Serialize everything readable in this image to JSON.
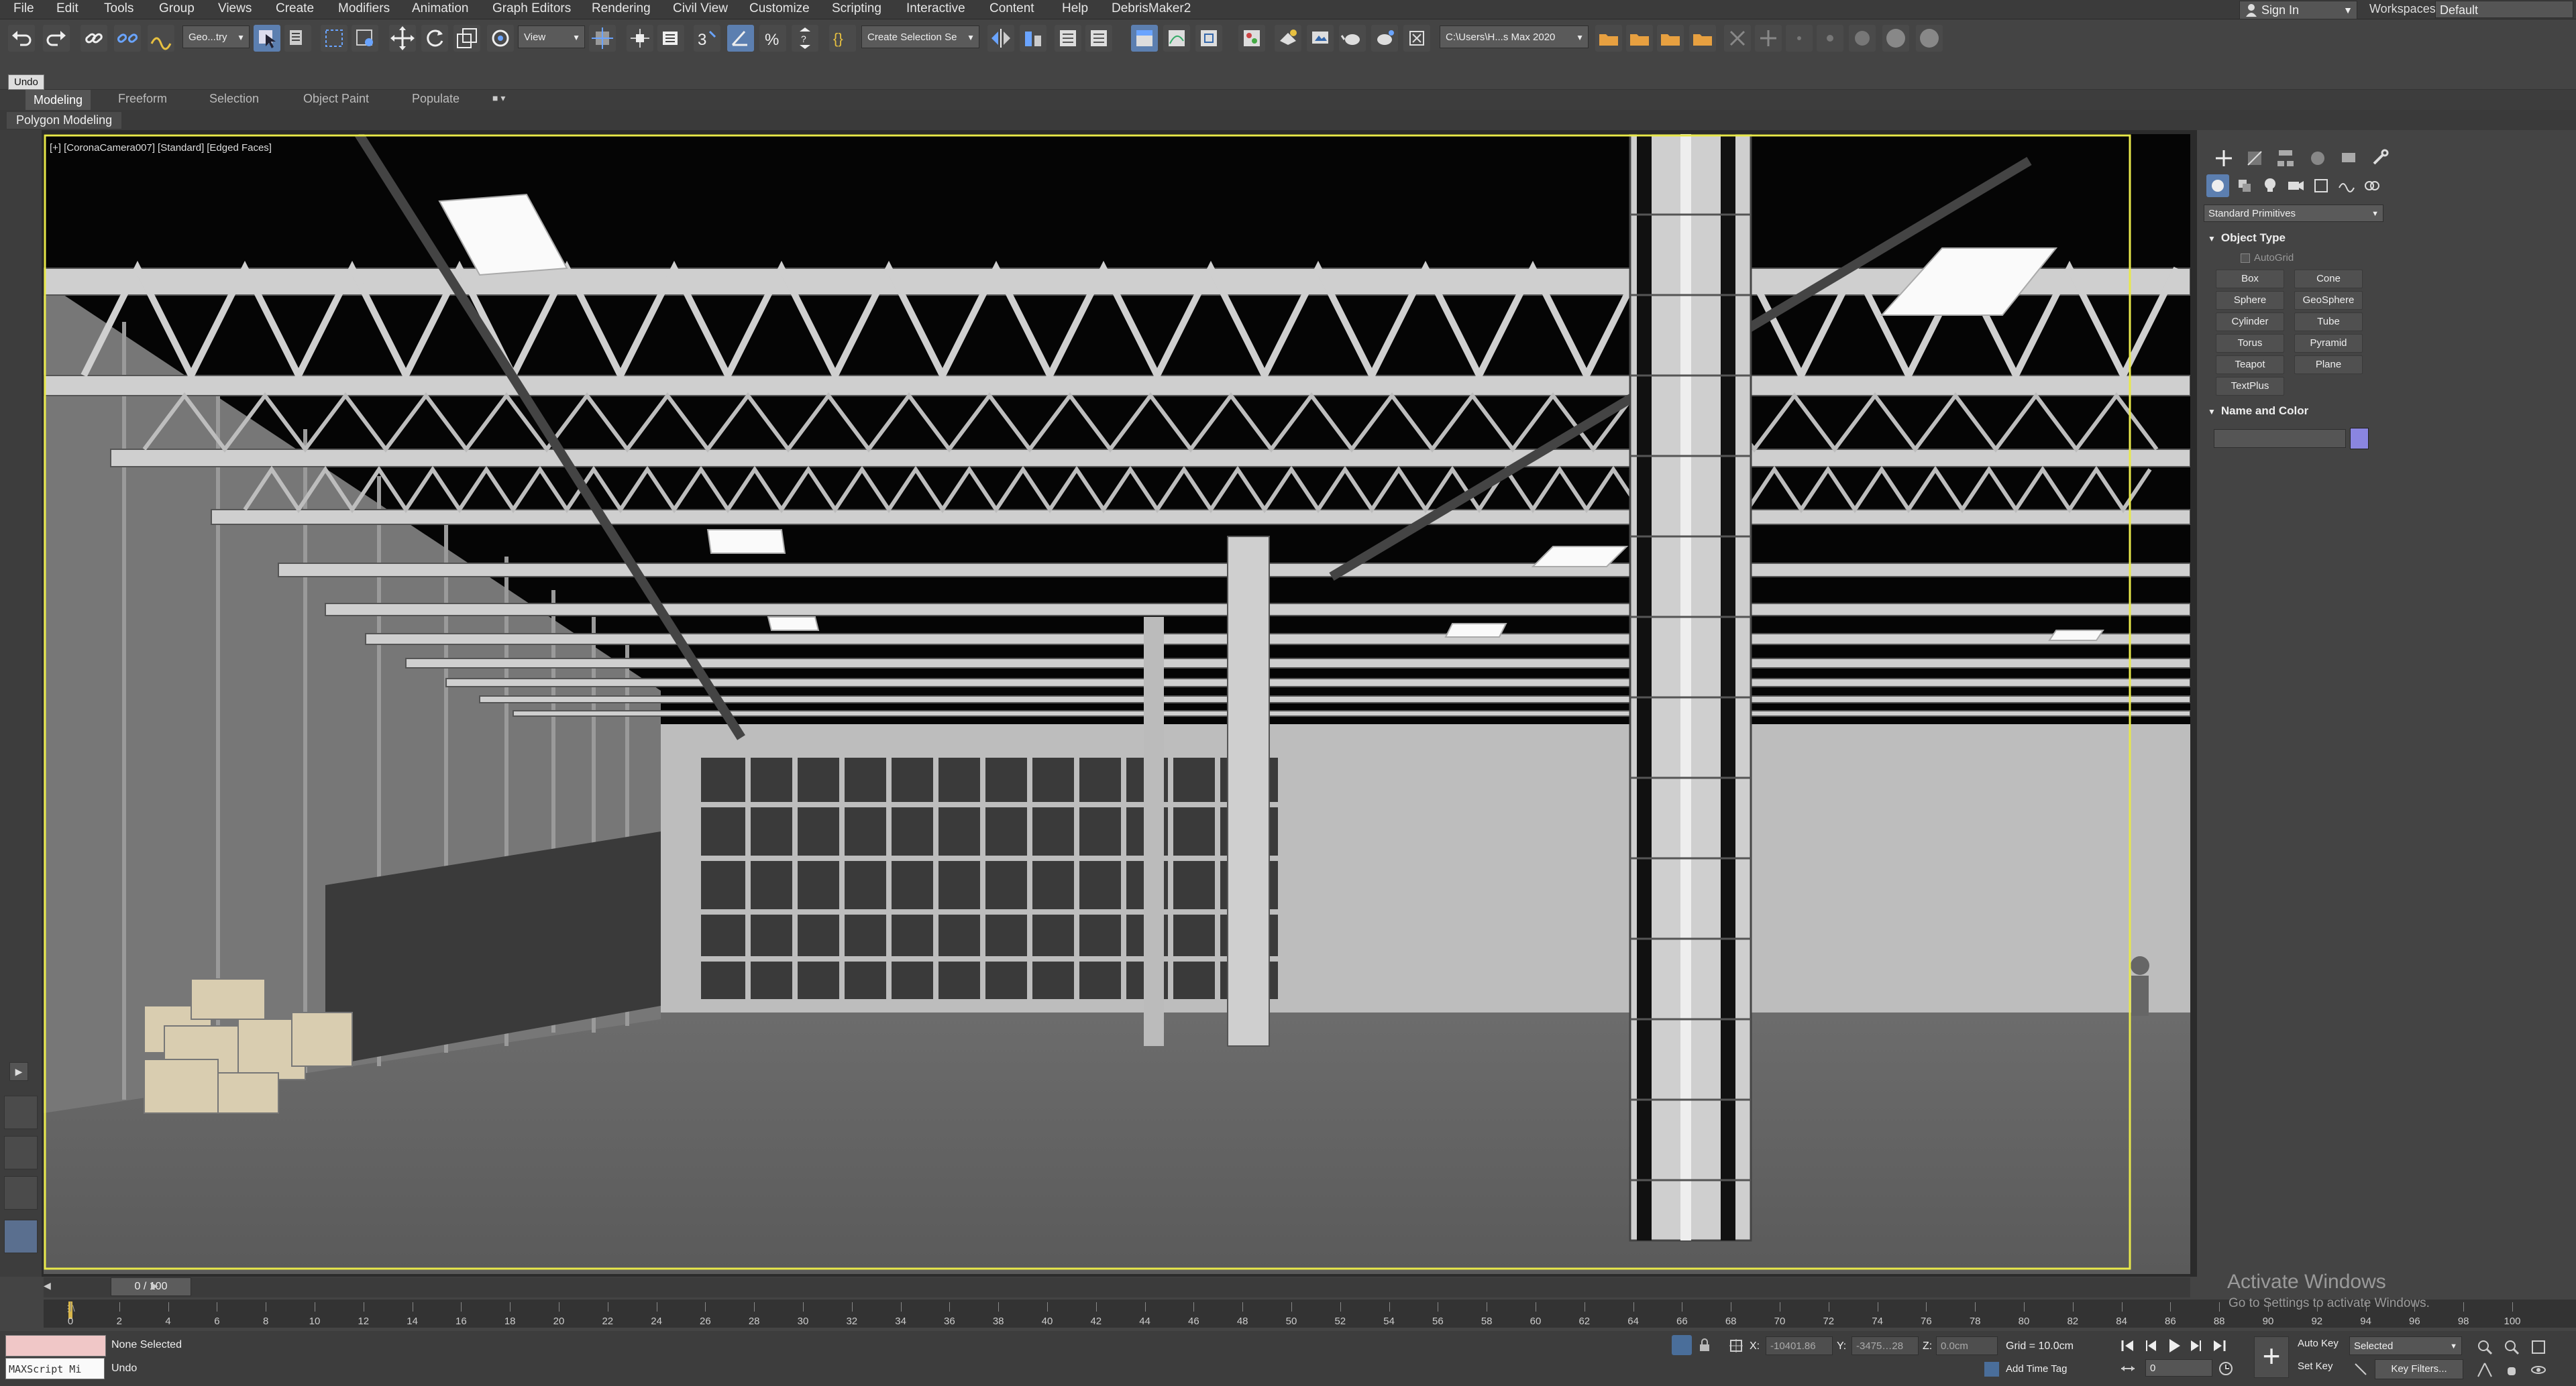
{
  "menu": [
    "File",
    "Edit",
    "Tools",
    "Group",
    "Views",
    "Create",
    "Modifiers",
    "Animation",
    "Graph Editors",
    "Rendering",
    "Civil View",
    "Customize",
    "Scripting",
    "Interactive",
    "Content",
    "Help",
    "DebrisMaker2"
  ],
  "account": {
    "signin_label": "Sign In",
    "workspaces_label": "Workspaces:",
    "workspace_value": "Default"
  },
  "toolbar": {
    "selection_filter": "Geo...try",
    "ref_coord": "View",
    "named_selection": "Create Selection Se",
    "project_path": "C:\\Users\\H...s Max 2020",
    "undo_tooltip": "Undo"
  },
  "ribbon": {
    "tabs": [
      "Modeling",
      "Freeform",
      "Selection",
      "Object Paint",
      "Populate"
    ],
    "active_tab": "Modeling",
    "panel": "Polygon Modeling"
  },
  "viewport": {
    "label_parts": [
      "[+]",
      "[CoronaCamera007]",
      "[Standard]",
      "[Edged Faces]"
    ]
  },
  "command_panel": {
    "category_dropdown": "Standard Primitives",
    "object_type_header": "Object Type",
    "autogrid_label": "AutoGrid",
    "primitives": [
      "Box",
      "Cone",
      "Sphere",
      "GeoSphere",
      "Cylinder",
      "Tube",
      "Torus",
      "Pyramid",
      "Teapot",
      "Plane",
      "TextPlus"
    ],
    "name_color_header": "Name and Color",
    "color": "#8a85e0"
  },
  "timeline": {
    "frame_display": "0 / 100",
    "ticks": [
      "0",
      "2",
      "4",
      "6",
      "8",
      "10",
      "12",
      "14",
      "16",
      "18",
      "20",
      "22",
      "24",
      "26",
      "28",
      "30",
      "32",
      "34",
      "36",
      "38",
      "40",
      "42",
      "44",
      "46",
      "48",
      "50",
      "52",
      "54",
      "56",
      "58",
      "60",
      "62",
      "64",
      "66",
      "68",
      "70",
      "72",
      "74",
      "76",
      "78",
      "80",
      "82",
      "84",
      "86",
      "88",
      "90",
      "92",
      "94",
      "96",
      "98",
      "100"
    ]
  },
  "status": {
    "maxscript_label": "MAXScript Mi",
    "selection": "None Selected",
    "last_action": "Undo",
    "x_label": "X:",
    "x_value": "-10401.86",
    "y_label": "Y:",
    "y_value": "-3475…28",
    "z_label": "Z:",
    "z_value": "0.0cm",
    "grid": "Grid = 10.0cm",
    "add_time_tag": "Add Time Tag",
    "frame_value": "0",
    "auto_key": "Auto Key",
    "set_key": "Set Key",
    "key_mode": "Selected",
    "key_filters": "Key Filters..."
  },
  "watermark": {
    "title": "Activate Windows",
    "subtitle": "Go to Settings to activate Windows."
  }
}
